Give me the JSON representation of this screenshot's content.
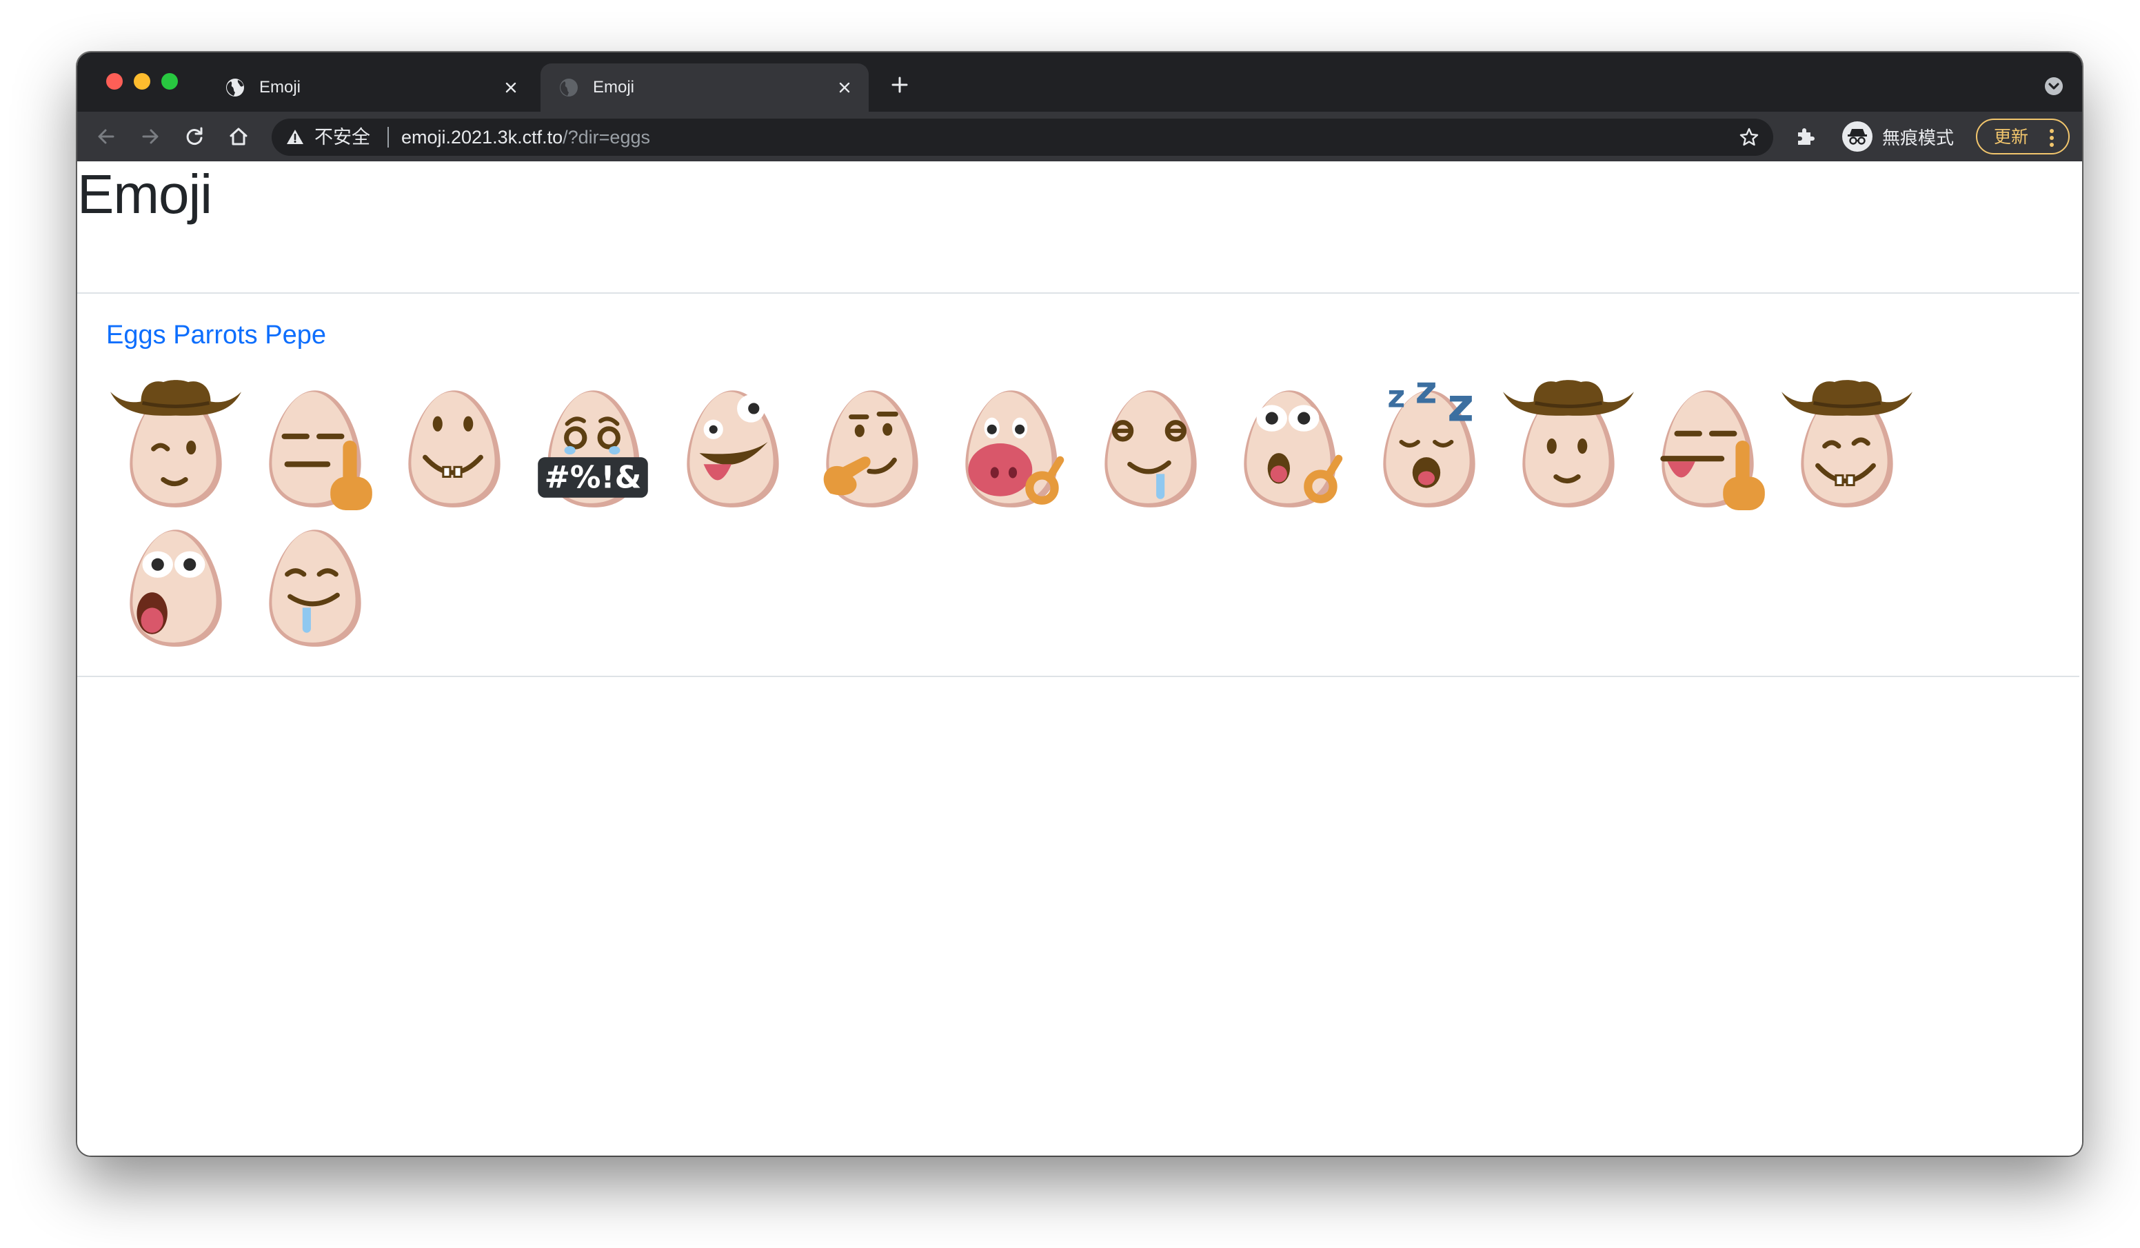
{
  "browser": {
    "tabs": [
      {
        "title": "Emoji",
        "active": false
      },
      {
        "title": "Emoji",
        "active": true
      }
    ],
    "omnibox": {
      "security_label": "不安全",
      "host": "emoji.2021.3k.ctf.to",
      "path": "/?dir=eggs"
    },
    "profile_label": "無痕模式",
    "update_label": "更新",
    "icons": [
      "globe-icon",
      "close-icon",
      "plus-icon",
      "tab-search-icon",
      "back-icon",
      "forward-icon",
      "reload-icon",
      "home-icon",
      "warning-icon",
      "star-icon",
      "puzzle-icon",
      "incognito-icon",
      "more-icon"
    ]
  },
  "page": {
    "title": "Emoji",
    "dir_links": [
      "Eggs",
      "Parrots",
      "Pepe"
    ],
    "emojis": [
      {
        "name": "egg-cowboy-wink"
      },
      {
        "name": "egg-middle-finger"
      },
      {
        "name": "egg-grin"
      },
      {
        "name": "egg-cursing"
      },
      {
        "name": "egg-zany"
      },
      {
        "name": "egg-thinking"
      },
      {
        "name": "egg-ok-hand-mouth"
      },
      {
        "name": "egg-drool-dizzy"
      },
      {
        "name": "egg-ok-surprised"
      },
      {
        "name": "egg-sleeping"
      },
      {
        "name": "egg-cowboy-smile"
      },
      {
        "name": "egg-tongue-middle-finger"
      },
      {
        "name": "egg-cowboy-grin"
      },
      {
        "name": "egg-shocked"
      },
      {
        "name": "egg-drool"
      }
    ],
    "colors": {
      "egg": "#f3d9c9",
      "egg_shade": "#d9a89b",
      "face": "#5d3f12",
      "hat": "#6b4a17",
      "hand": "#e69a3c",
      "tongue": "#d9576a",
      "drool": "#8fc8f0",
      "link": "#0d6efd"
    }
  }
}
